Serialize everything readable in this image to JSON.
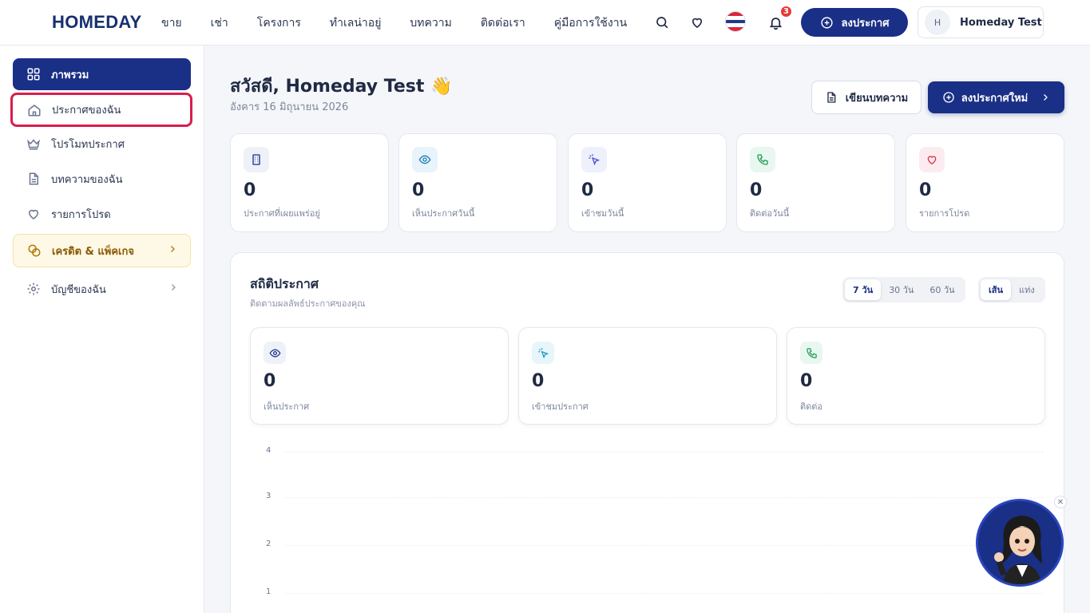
{
  "header": {
    "logo": "HOMEDAY",
    "nav": [
      "ขาย",
      "เช่า",
      "โครงการ",
      "ทำเลน่าอยู่",
      "บทความ",
      "ติดต่อเรา",
      "คู่มือการใช้งาน"
    ],
    "notification_count": "3",
    "post_button": "ลงประกาศ",
    "user_initial": "H",
    "user_name": "Homeday Test"
  },
  "sidebar": {
    "items": [
      {
        "label": "ภาพรวม",
        "icon": "dashboard-icon"
      },
      {
        "label": "ประกาศของฉัน",
        "icon": "home-icon"
      },
      {
        "label": "โปรโมทประกาศ",
        "icon": "crown-icon"
      },
      {
        "label": "บทความของฉัน",
        "icon": "document-icon"
      },
      {
        "label": "รายการโปรด",
        "icon": "heart-icon"
      },
      {
        "label": "เครดิต & แพ็คเกจ",
        "icon": "coins-icon"
      },
      {
        "label": "บัญชีของฉัน",
        "icon": "gear-icon"
      }
    ]
  },
  "main": {
    "greeting": "สวัสดี, Homeday Test 👋",
    "date": "อังคาร 16 มิถุนายน 2026",
    "write_article": "เขียนบทความ",
    "new_post": "ลงประกาศใหม่",
    "stats": [
      {
        "value": "0",
        "label": "ประกาศที่เผยแพร่อยู่",
        "icon": "building-icon"
      },
      {
        "value": "0",
        "label": "เห็นประกาศวันนี้",
        "icon": "eye-icon"
      },
      {
        "value": "0",
        "label": "เข้าชมวันนี้",
        "icon": "cursor-click-icon"
      },
      {
        "value": "0",
        "label": "ติดต่อวันนี้",
        "icon": "phone-icon"
      },
      {
        "value": "0",
        "label": "รายการโปรด",
        "icon": "heart-icon"
      }
    ]
  },
  "analytics": {
    "title": "สถิติประกาศ",
    "subtitle": "ติดตามผลลัพธ์ประกาศของคุณ",
    "ranges": [
      "7 วัน",
      "30 วัน",
      "60 วัน"
    ],
    "selected_range": "7 วัน",
    "chart_types": [
      "เส้น",
      "แท่ง"
    ],
    "selected_chart_type": "เส้น",
    "summary": [
      {
        "value": "0",
        "label": "เห็นประกาศ",
        "icon": "eye-icon"
      },
      {
        "value": "0",
        "label": "เข้าชมประกาศ",
        "icon": "cursor-click-icon"
      },
      {
        "value": "0",
        "label": "ติดต่อ",
        "icon": "phone-icon"
      }
    ]
  },
  "chart_data": {
    "type": "line",
    "y_ticks": [
      "4",
      "3",
      "2",
      "1"
    ],
    "grid": true
  },
  "colors": {
    "primary": "#1a2f86",
    "focus_ring": "#d81e4b",
    "credit_bg": "#fef8e6"
  }
}
